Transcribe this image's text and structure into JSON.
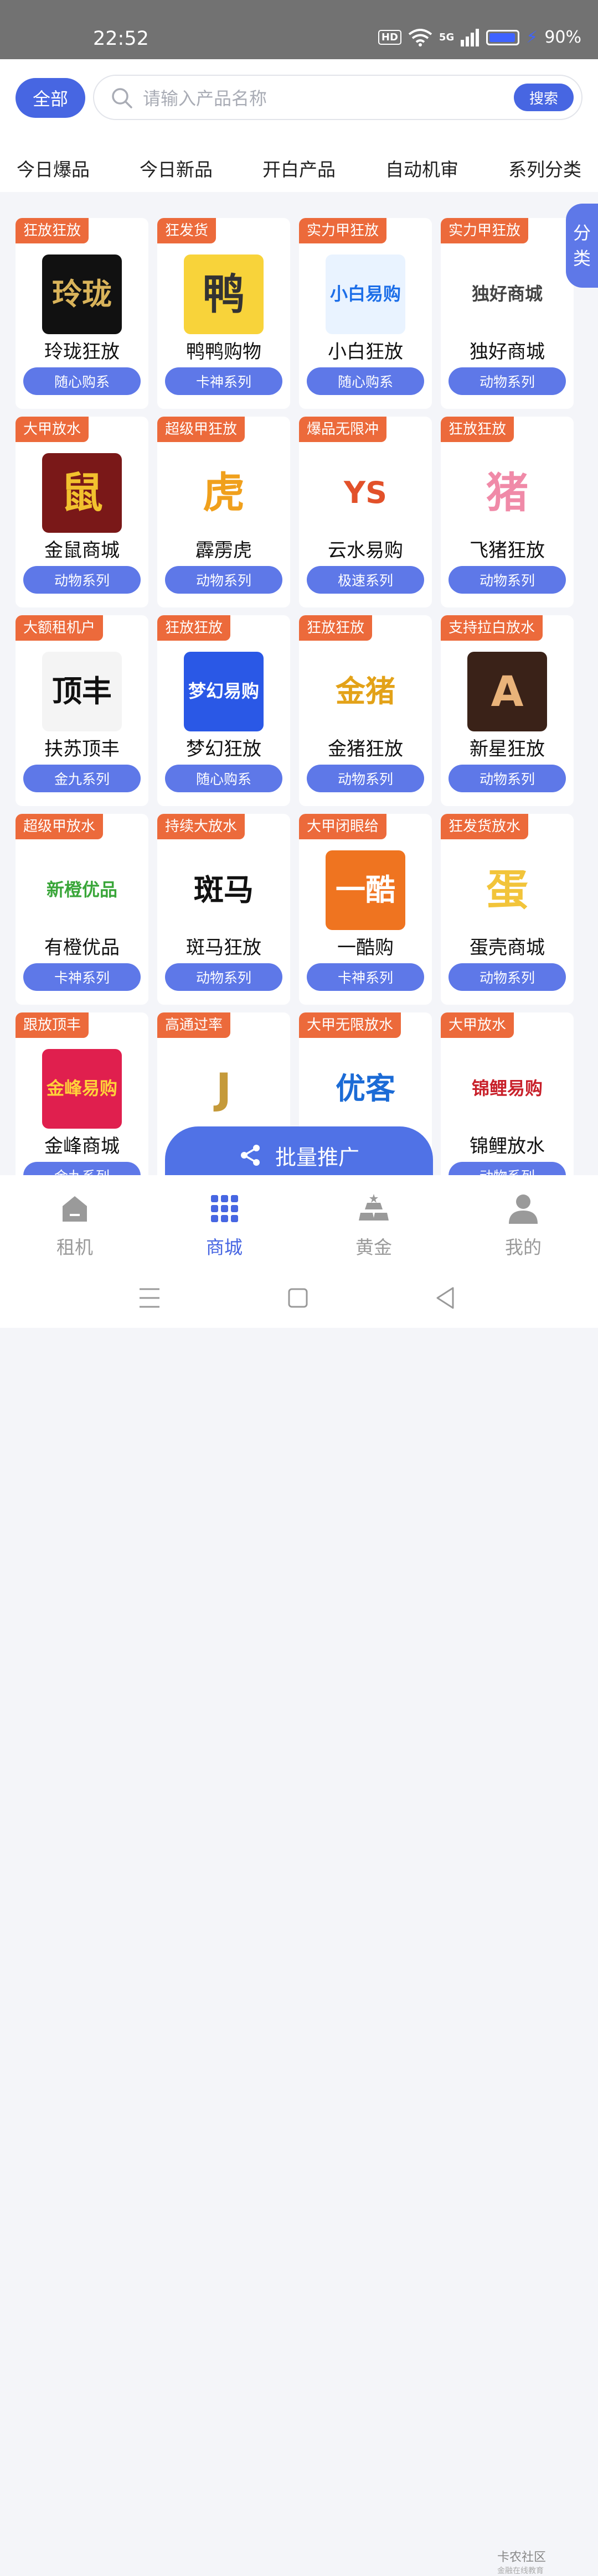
{
  "status": {
    "time": "22:52",
    "hd": "HD",
    "network": "5G",
    "battery": "90%"
  },
  "header": {
    "all_label": "全部",
    "search": {
      "placeholder": "请输入产品名称",
      "button": "搜索"
    },
    "tabs": [
      "今日爆品",
      "今日新品",
      "开白产品",
      "自动机审",
      "系列分类"
    ]
  },
  "side_tab": {
    "line1": "分",
    "line2": "类"
  },
  "products": [
    {
      "badge": "狂放狂放",
      "name": "玲珑狂放",
      "series": "随心购系",
      "logo_text": "玲珑",
      "logo_bg": "#111111",
      "logo_fg": "#d9b35a"
    },
    {
      "badge": "狂发货",
      "name": "鸭鸭购物",
      "series": "卡神系列",
      "logo_text": "鸭",
      "logo_bg": "#f8d33a",
      "logo_fg": "#333333"
    },
    {
      "badge": "实力甲狂放",
      "name": "小白狂放",
      "series": "随心购系",
      "logo_text": "小白易购",
      "logo_bg": "#e9f3ff",
      "logo_fg": "#1c6ee8"
    },
    {
      "badge": "实力甲狂放",
      "name": "独好商城",
      "series": "动物系列",
      "logo_text": "独好商城",
      "logo_bg": "#ffffff",
      "logo_fg": "#444444"
    },
    {
      "badge": "大甲放水",
      "name": "金鼠商城",
      "series": "动物系列",
      "logo_text": "鼠",
      "logo_bg": "#7a1818",
      "logo_fg": "#f2c12e"
    },
    {
      "badge": "超级甲狂放",
      "name": "霹雳虎",
      "series": "动物系列",
      "logo_text": "虎",
      "logo_bg": "#ffffff",
      "logo_fg": "#f0a01c"
    },
    {
      "badge": "爆品无限冲",
      "name": "云水易购",
      "series": "极速系列",
      "logo_text": "YS",
      "logo_bg": "#ffffff",
      "logo_fg": "#e2512a"
    },
    {
      "badge": "狂放狂放",
      "name": "飞猪狂放",
      "series": "动物系列",
      "logo_text": "猪",
      "logo_bg": "#ffffff",
      "logo_fg": "#f08aa8"
    },
    {
      "badge": "大额租机户",
      "name": "扶苏顶丰",
      "series": "金九系列",
      "logo_text": "顶丰",
      "logo_bg": "#f4f4f4",
      "logo_fg": "#111111"
    },
    {
      "badge": "狂放狂放",
      "name": "梦幻狂放",
      "series": "随心购系",
      "logo_text": "梦幻易购",
      "logo_bg": "#2a58e6",
      "logo_fg": "#ffffff"
    },
    {
      "badge": "狂放狂放",
      "name": "金猪狂放",
      "series": "动物系列",
      "logo_text": "金猪",
      "logo_bg": "#ffffff",
      "logo_fg": "#e3a218"
    },
    {
      "badge": "支持拉白放水",
      "name": "新星狂放",
      "series": "动物系列",
      "logo_text": "A",
      "logo_bg": "#3a2218",
      "logo_fg": "#e9b37a"
    },
    {
      "badge": "超级甲放水",
      "name": "有橙优品",
      "series": "卡神系列",
      "logo_text": "新橙优品",
      "logo_bg": "#ffffff",
      "logo_fg": "#3aa63a"
    },
    {
      "badge": "持续大放水",
      "name": "斑马狂放",
      "series": "动物系列",
      "logo_text": "斑马",
      "logo_bg": "#ffffff",
      "logo_fg": "#111111"
    },
    {
      "badge": "大甲闭眼给",
      "name": "一酷购",
      "series": "卡神系列",
      "logo_text": "一酷",
      "logo_bg": "#ef7420",
      "logo_fg": "#ffffff"
    },
    {
      "badge": "狂发货放水",
      "name": "蛋壳商城",
      "series": "动物系列",
      "logo_text": "蛋",
      "logo_bg": "#ffffff",
      "logo_fg": "#f2c43a"
    },
    {
      "badge": "跟放顶丰",
      "name": "金峰商城",
      "series": "金九系列",
      "logo_text": "金峰易购",
      "logo_bg": "#e01f4e",
      "logo_fg": "#ffd23a"
    },
    {
      "badge": "高通过率",
      "name": "",
      "series": "",
      "logo_text": "J",
      "logo_bg": "#ffffff",
      "logo_fg": "#c59a3a"
    },
    {
      "badge": "大甲无限放水",
      "name": "",
      "series": "",
      "logo_text": "优客",
      "logo_bg": "#ffffff",
      "logo_fg": "#1b6bd6"
    },
    {
      "badge": "大甲放水",
      "name": "锦鲤放水",
      "series": "动物系列",
      "logo_text": "锦鲤易购",
      "logo_bg": "#ffffff",
      "logo_fg": "#c8202a"
    }
  ],
  "promote": {
    "label": "批量推广"
  },
  "bottom_nav": [
    {
      "label": "租机",
      "icon": "home-icon"
    },
    {
      "label": "商城",
      "icon": "grid-icon",
      "active": true
    },
    {
      "label": "黄金",
      "icon": "gold-icon"
    },
    {
      "label": "我的",
      "icon": "user-icon"
    }
  ],
  "watermark": {
    "title": "卡农社区",
    "subtitle": "金融在线教育"
  },
  "colors": {
    "accent": "#4766e2",
    "badge": "#ec6a3b"
  }
}
